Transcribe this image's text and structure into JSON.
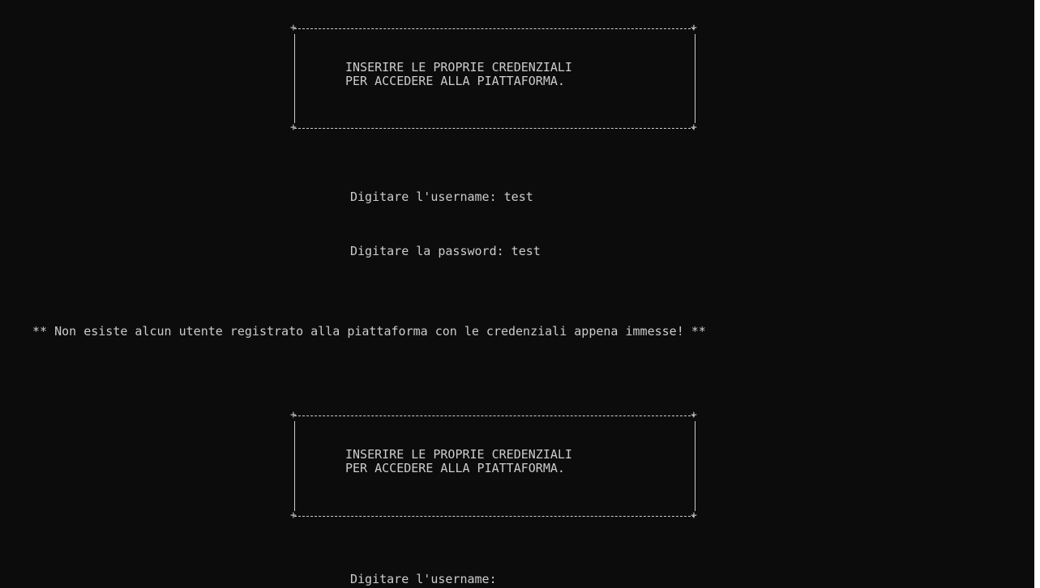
{
  "console": {
    "box1": {
      "line1": "INSERIRE LE PROPRIE CREDENZIALI",
      "line2": "PER ACCEDERE ALLA PIATTAFORMA."
    },
    "username_prompt_1": "Digitare l'username: test",
    "password_prompt_1": "Digitare la password: test",
    "error_message": "** Non esiste alcun utente registrato alla piattaforma con le credenziali appena immesse! **",
    "box2": {
      "line1": "INSERIRE LE PROPRIE CREDENZIALI",
      "line2": "PER ACCEDERE ALLA PIATTAFORMA."
    },
    "username_prompt_2": "Digitare l'username:"
  },
  "colors": {
    "background": "#0c0c0c",
    "text": "#cccccc"
  }
}
